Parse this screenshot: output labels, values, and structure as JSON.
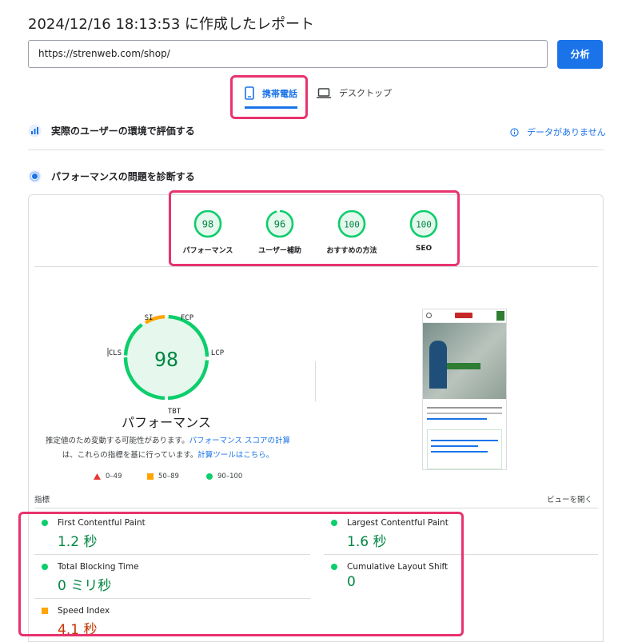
{
  "header": {
    "report_title": "2024/12/16 18:13:53 に作成したレポート"
  },
  "search": {
    "url": "https://strenweb.com/shop/",
    "analyze_label": "分析"
  },
  "tabs": [
    {
      "label": "携帯電話",
      "icon": "mobile-phone-icon",
      "active": true
    },
    {
      "label": "デスクトップ",
      "icon": "laptop-icon",
      "active": false
    }
  ],
  "field_data": {
    "title": "実際のユーザーの環境で評価する",
    "status": "データがありません"
  },
  "diagnose": {
    "title": "パフォーマンスの問題を診断する"
  },
  "scores": [
    {
      "value": "98",
      "label": "パフォーマンス"
    },
    {
      "value": "96",
      "label": "ユーザー補助"
    },
    {
      "value": "100",
      "label": "おすすめの方法"
    },
    {
      "value": "100",
      "label": "SEO"
    }
  ],
  "performance": {
    "score": "98",
    "title": "パフォーマンス",
    "gauge_labels": {
      "si": "SI",
      "fcp": "FCP",
      "lcp": "LCP",
      "tbt": "TBT",
      "cls": "CLS"
    },
    "desc_line1_prefix": "推定値のため変動する可能性があります。",
    "desc_link1": "パフォーマンス スコアの計算",
    "desc_line2_prefix": "は、これらの指標を基に行っています。",
    "desc_link2": "計算ツールはこちら。"
  },
  "legend": [
    {
      "range": "0–49",
      "shape": "triangle",
      "color": "#e53935"
    },
    {
      "range": "50–89",
      "shape": "square",
      "color": "#ffa400"
    },
    {
      "range": "90–100",
      "shape": "circle",
      "color": "#0cce6b"
    }
  ],
  "metrics_header": {
    "label": "指標",
    "view_label": "ビューを開く"
  },
  "metrics": [
    {
      "name": "First Contentful Paint",
      "value": "1.2 秒",
      "status": "good"
    },
    {
      "name": "Largest Contentful Paint",
      "value": "1.6 秒",
      "status": "good"
    },
    {
      "name": "Total Blocking Time",
      "value": "0 ミリ秒",
      "status": "good"
    },
    {
      "name": "Cumulative Layout Shift",
      "value": "0",
      "status": "good"
    },
    {
      "name": "Speed Index",
      "value": "4.1 秒",
      "status": "average"
    }
  ],
  "colors": {
    "accent": "#1a73e8",
    "good": "#0cce6b",
    "good_text": "#018642",
    "average": "#ffa400",
    "average_text": "#c33300",
    "poor": "#e53935",
    "highlight": "#e8336d"
  }
}
